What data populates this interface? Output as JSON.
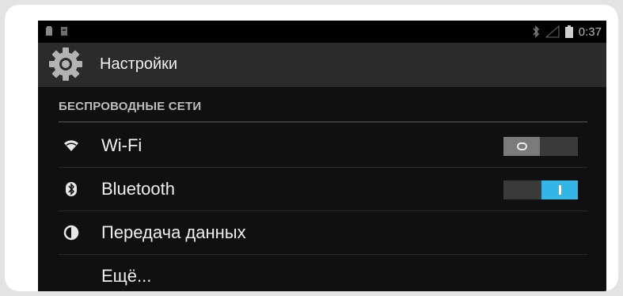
{
  "status_bar": {
    "time": "0:37",
    "icons": [
      "notification-icon",
      "notification-icon",
      "bluetooth-icon",
      "signal-icon",
      "battery-icon"
    ]
  },
  "action_bar": {
    "title": "Настройки",
    "icon": "settings-gear-icon"
  },
  "section": {
    "header": "БЕСПРОВОДНЫЕ СЕТИ"
  },
  "rows": [
    {
      "label": "Wi-Fi",
      "icon": "wifi-icon",
      "toggle": "off"
    },
    {
      "label": "Bluetooth",
      "icon": "bluetooth-icon",
      "toggle": "on"
    },
    {
      "label": "Передача данных",
      "icon": "data-usage-icon"
    },
    {
      "label": "Ещё...",
      "icon": ""
    }
  ],
  "colors": {
    "accent": "#33b5e5",
    "background": "#101010",
    "action_bar": "#2b2b2b"
  }
}
